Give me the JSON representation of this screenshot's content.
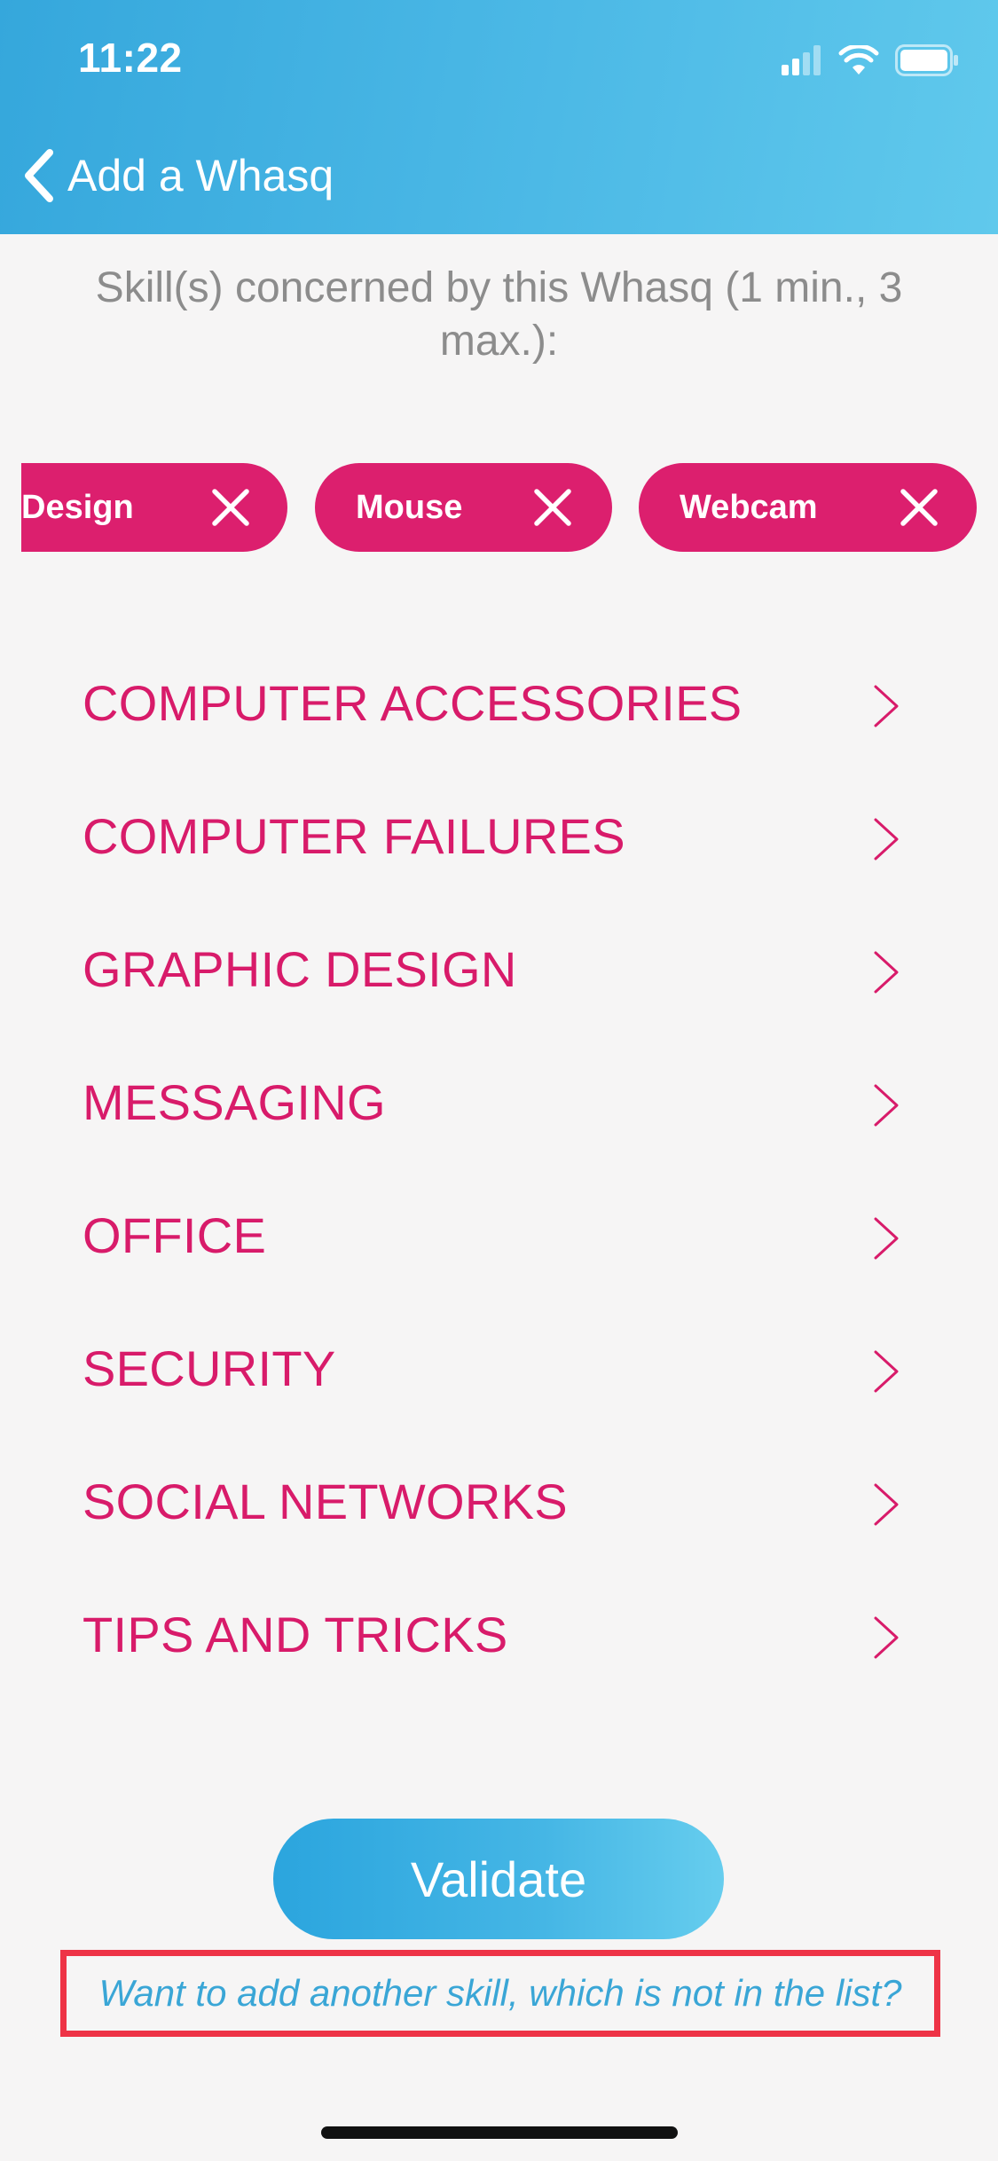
{
  "status_bar": {
    "time": "11:22"
  },
  "nav": {
    "back_label": "Add a Whasq",
    "back_icon": "chevron-left-icon"
  },
  "subtitle": "Skill(s) concerned by this Whasq (1 min., 3 max.):",
  "selected_skills": [
    {
      "label": "Design",
      "remove_icon": "close-icon"
    },
    {
      "label": "Mouse",
      "remove_icon": "close-icon"
    },
    {
      "label": "Webcam",
      "remove_icon": "close-icon"
    }
  ],
  "categories": [
    {
      "label": "COMPUTER ACCESSORIES"
    },
    {
      "label": "COMPUTER FAILURES"
    },
    {
      "label": "GRAPHIC DESIGN"
    },
    {
      "label": "MESSAGING"
    },
    {
      "label": "OFFICE"
    },
    {
      "label": "SECURITY"
    },
    {
      "label": "SOCIAL NETWORKS"
    },
    {
      "label": "TIPS AND TRICKS"
    }
  ],
  "validate_label": "Validate",
  "add_skill_link": "Want to add another skill, which is not in the list?",
  "colors": {
    "header_blue": "#4cb9e6",
    "accent_pink": "#dc1f6e",
    "link_blue": "#3aa6d6",
    "highlight_red": "#ee3346",
    "background": "#f6f5f5"
  }
}
